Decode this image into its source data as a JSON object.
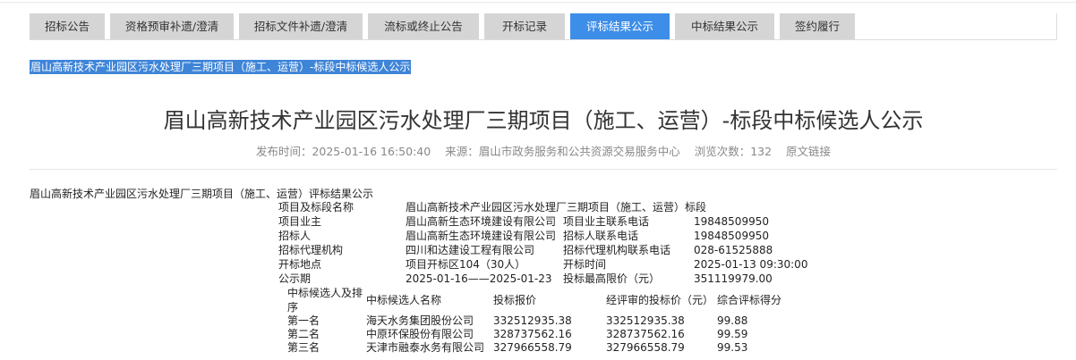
{
  "tabs": [
    {
      "label": "招标公告",
      "active": false
    },
    {
      "label": "资格预审补遗/澄清",
      "active": false
    },
    {
      "label": "招标文件补遗/澄清",
      "active": false
    },
    {
      "label": "流标或终止公告",
      "active": false
    },
    {
      "label": "开标记录",
      "active": false
    },
    {
      "label": "评标结果公示",
      "active": true
    },
    {
      "label": "中标结果公示",
      "active": false
    },
    {
      "label": "签约履行",
      "active": false
    }
  ],
  "selected_title": "眉山高新技术产业园区污水处理厂三期项目（施工、运营）-标段中标候选人公示",
  "title": "眉山高新技术产业园区污水处理厂三期项目（施工、运营）-标段中标候选人公示",
  "meta": {
    "publish": "发布时间：2025-01-16 16:50:40",
    "source": "来源：眉山市政务服务和公共资源交易服务中心",
    "views": "浏览次数：132",
    "original_link": "原文链接"
  },
  "body_title": "眉山高新技术产业园区污水处理厂三期项目（施工、运营）评标结果公示",
  "info_rows": [
    [
      "项目及标段名称",
      "眉山高新技术产业园区污水处理厂三期项目（施工、运营）标段",
      "",
      ""
    ],
    [
      "项目业主",
      "眉山高新生态环境建设有限公司",
      "项目业主联系电话",
      "19848509950"
    ],
    [
      "招标人",
      "眉山高新生态环境建设有限公司",
      "招标人联系电话",
      "19848509950"
    ],
    [
      "招标代理机构",
      "四川和达建设工程有限公司",
      "招标代理机构联系电话",
      "028-61525888"
    ],
    [
      "开标地点",
      "项目开标区104（30人）",
      "开标时间",
      "2025-01-13 09:30:00"
    ],
    [
      "公示期",
      "2025-01-16——2025-01-23",
      "投标最高限价（元）",
      "351119979.00"
    ]
  ],
  "candidate_headers": {
    "rank": "中标候选人及排序",
    "name": "中标候选人名称",
    "bid": "投标报价",
    "reviewed": "经评审的投标价（元）",
    "score": "综合评标得分"
  },
  "candidates": [
    {
      "rank": "第一名",
      "name": "海天水务集团股份公司",
      "bid": "332512935.38",
      "reviewed": "332512935.38",
      "score": "99.88"
    },
    {
      "rank": "第二名",
      "name": "中原环保股份有限公司",
      "bid": "328737562.16",
      "reviewed": "328737562.16",
      "score": "99.59"
    },
    {
      "rank": "第三名",
      "name": "天津市融泰水务有限公司",
      "bid": "327966558.79",
      "reviewed": "327966558.79",
      "score": "99.53"
    }
  ]
}
